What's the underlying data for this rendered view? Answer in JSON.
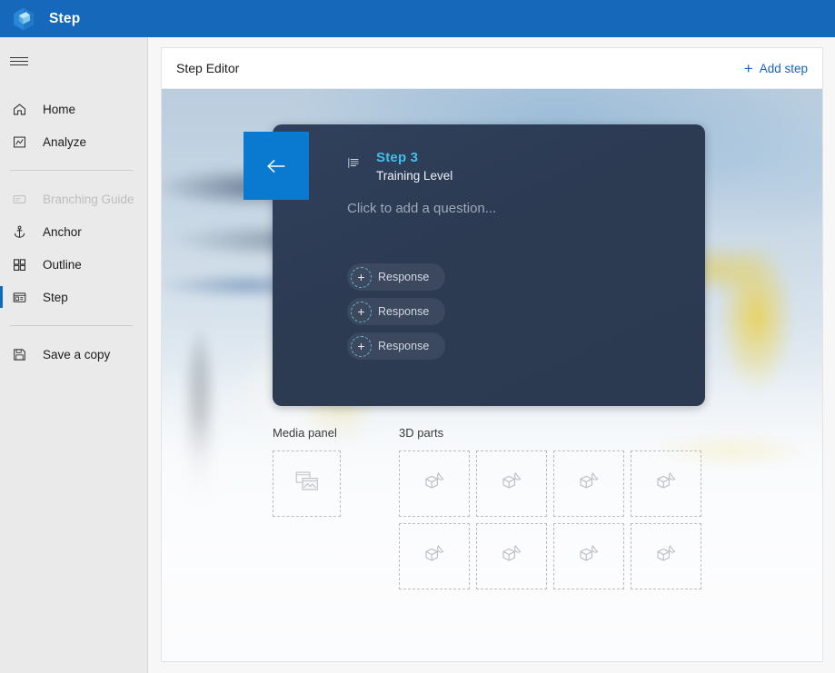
{
  "app": {
    "title": "Step",
    "logo_icon": "cube-logo-icon",
    "brand_color": "#1668bb",
    "accent_color": "#0f6cbd"
  },
  "sidebar": {
    "menu_icon": "hamburger-icon",
    "items": [
      {
        "id": "home",
        "label": "Home",
        "icon": "home-icon",
        "active": false,
        "disabled": false
      },
      {
        "id": "analyze",
        "label": "Analyze",
        "icon": "analyze-icon",
        "active": false,
        "disabled": false
      },
      {
        "id": "branching",
        "label": "Branching Guide",
        "icon": "branching-icon",
        "active": false,
        "disabled": true
      },
      {
        "id": "anchor",
        "label": "Anchor",
        "icon": "anchor-icon",
        "active": false,
        "disabled": false
      },
      {
        "id": "outline",
        "label": "Outline",
        "icon": "outline-icon",
        "active": false,
        "disabled": false
      },
      {
        "id": "step",
        "label": "Step",
        "icon": "step-icon",
        "active": true,
        "disabled": false
      },
      {
        "id": "savecopy",
        "label": "Save a copy",
        "icon": "save-icon",
        "active": false,
        "disabled": false
      }
    ]
  },
  "editor": {
    "title": "Step Editor",
    "add_step_label": "Add step",
    "add_step_icon": "plus-icon",
    "add_step_color": "#1565c0"
  },
  "step_card": {
    "back_icon": "back-arrow-icon",
    "list_icon": "outline-list-icon",
    "step_number": "Step 3",
    "step_number_color": "#40bfe8",
    "subtitle": "Training Level",
    "question_placeholder": "Click to add a question...",
    "responses": [
      {
        "label": "Response",
        "icon": "plus-icon"
      },
      {
        "label": "Response",
        "icon": "plus-icon"
      },
      {
        "label": "Response",
        "icon": "plus-icon"
      }
    ]
  },
  "media_panel": {
    "label": "Media panel",
    "slots": [
      {
        "icon": "image-placeholder-icon"
      }
    ]
  },
  "parts_panel": {
    "label": "3D parts",
    "slots": [
      {
        "icon": "3d-part-icon"
      },
      {
        "icon": "3d-part-icon"
      },
      {
        "icon": "3d-part-icon"
      },
      {
        "icon": "3d-part-icon"
      },
      {
        "icon": "3d-part-icon"
      },
      {
        "icon": "3d-part-icon"
      },
      {
        "icon": "3d-part-icon"
      },
      {
        "icon": "3d-part-icon"
      }
    ]
  }
}
